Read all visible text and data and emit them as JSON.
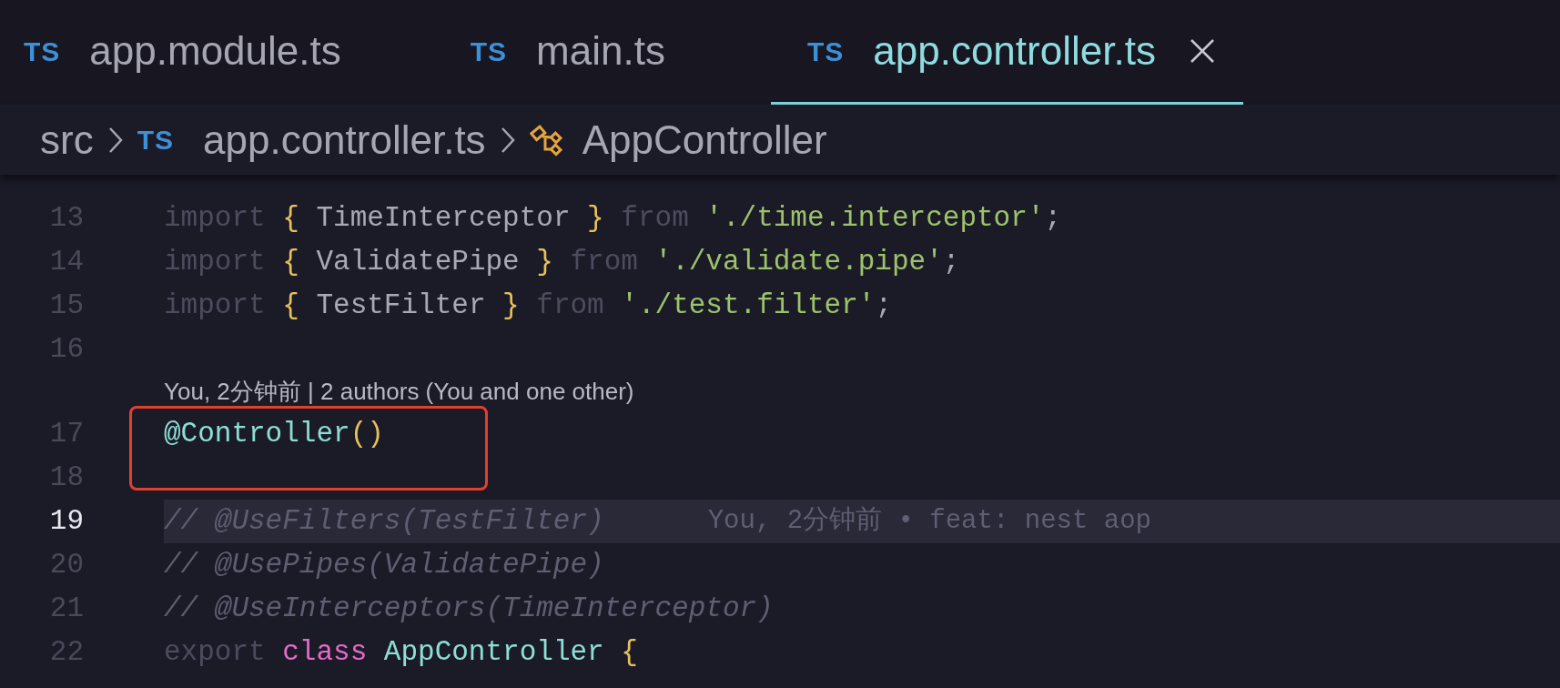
{
  "tabs": [
    {
      "icon": "TS",
      "label": "app.module.ts",
      "selected": false
    },
    {
      "icon": "TS",
      "label": "main.ts",
      "selected": false
    },
    {
      "icon": "TS",
      "label": "app.controller.ts",
      "selected": true
    }
  ],
  "breadcrumb": [
    {
      "kind": "folder",
      "label": "src"
    },
    {
      "kind": "file",
      "icon": "TS",
      "label": "app.controller.ts"
    },
    {
      "kind": "symbol",
      "label": "AppController"
    }
  ],
  "lines": [
    {
      "kind": "code",
      "number": "13",
      "current": false,
      "tokens": [
        {
          "kind": "keyword",
          "t": "import "
        },
        {
          "kind": "brace",
          "t": "{ "
        },
        {
          "kind": "ident",
          "t": "TimeInterceptor "
        },
        {
          "kind": "brace",
          "t": "}"
        },
        {
          "kind": "keyword",
          "t": " from "
        },
        {
          "kind": "string",
          "t": "'./time.interceptor'"
        },
        {
          "kind": "punct",
          "t": ";"
        }
      ]
    },
    {
      "kind": "code",
      "number": "14",
      "current": false,
      "tokens": [
        {
          "kind": "keyword",
          "t": "import "
        },
        {
          "kind": "brace",
          "t": "{ "
        },
        {
          "kind": "ident",
          "t": "ValidatePipe "
        },
        {
          "kind": "brace",
          "t": "}"
        },
        {
          "kind": "keyword",
          "t": " from "
        },
        {
          "kind": "string",
          "t": "'./validate.pipe'"
        },
        {
          "kind": "punct",
          "t": ";"
        }
      ]
    },
    {
      "kind": "code",
      "number": "15",
      "current": false,
      "tokens": [
        {
          "kind": "keyword",
          "t": "import "
        },
        {
          "kind": "brace",
          "t": "{ "
        },
        {
          "kind": "ident",
          "t": "TestFilter "
        },
        {
          "kind": "brace",
          "t": "}"
        },
        {
          "kind": "keyword",
          "t": " from "
        },
        {
          "kind": "string",
          "t": "'./test.filter'"
        },
        {
          "kind": "punct",
          "t": ";"
        }
      ]
    },
    {
      "kind": "code",
      "number": "16",
      "current": false
    },
    {
      "kind": "codelens",
      "text": "You, 2分钟前 | 2 authors (You and one other)"
    },
    {
      "kind": "code",
      "number": "17",
      "current": false,
      "tokens": [
        {
          "kind": "decorator",
          "t": "@Controller"
        },
        {
          "kind": "brace",
          "t": "()"
        }
      ]
    },
    {
      "kind": "code",
      "number": "18",
      "current": false
    },
    {
      "kind": "code",
      "number": "19",
      "current": true,
      "blame": "You, 2分钟前 • feat: nest aop",
      "tokens": [
        {
          "kind": "comment",
          "t": "// @UseFilters(TestFilter)"
        }
      ]
    },
    {
      "kind": "code",
      "number": "20",
      "current": false,
      "tokens": [
        {
          "kind": "comment",
          "t": "// @UsePipes(ValidatePipe)"
        }
      ]
    },
    {
      "kind": "code",
      "number": "21",
      "current": false,
      "tokens": [
        {
          "kind": "comment",
          "t": "// @UseInterceptors(TimeInterceptor)"
        }
      ]
    },
    {
      "kind": "code",
      "number": "22",
      "current": false,
      "tokens": [
        {
          "kind": "keyword",
          "t": "export "
        },
        {
          "kind": "storage",
          "t": "class "
        },
        {
          "kind": "class",
          "t": "AppController "
        },
        {
          "kind": "brace",
          "t": "{"
        }
      ]
    }
  ]
}
